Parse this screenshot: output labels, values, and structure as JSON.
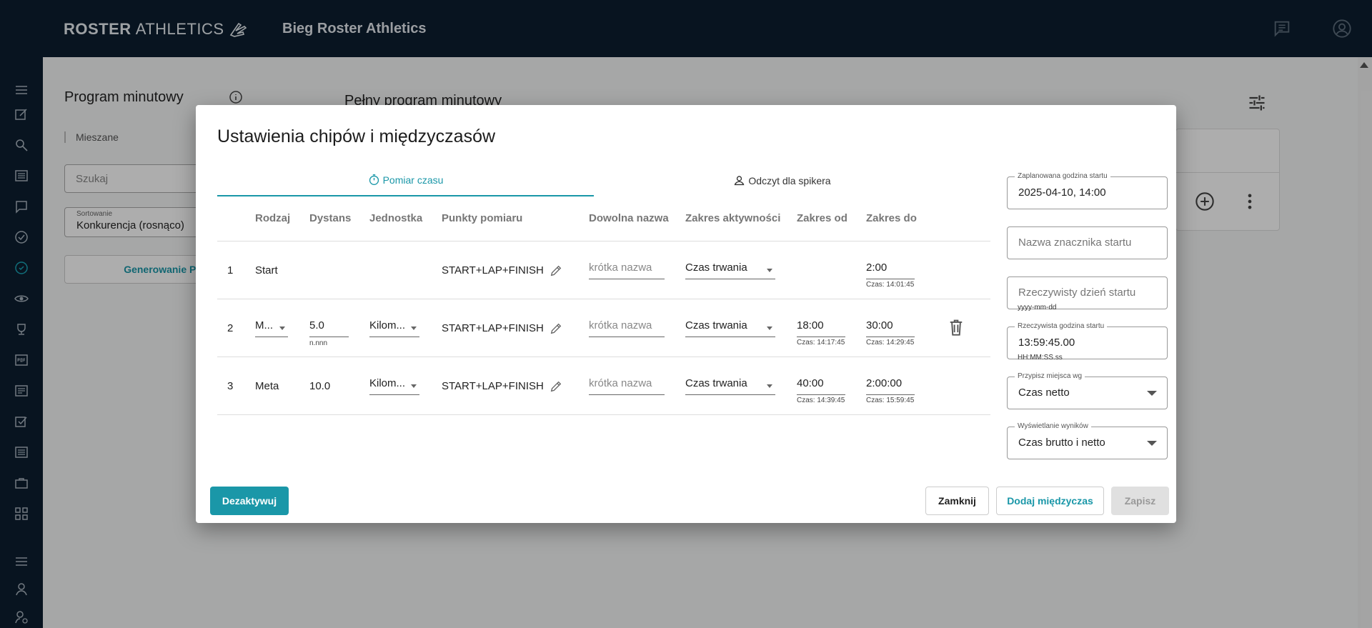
{
  "header": {
    "logo_bold": "ROSTER",
    "logo_light": "ATHLETICS",
    "event_title": "Bieg Roster Athletics"
  },
  "background": {
    "title": "Program minutowy",
    "full_title": "Pełny program minutowy",
    "tag": "Mieszane",
    "search_placeholder": "Szukaj",
    "sort_label": "Sortowanie",
    "sort_value": "Konkurencja (rosnąco)",
    "pdf_button": "Generowanie PDF"
  },
  "dialog": {
    "title": "Ustawienia chipów i międzyczasów",
    "tabs": [
      {
        "label": "Pomiar czasu",
        "icon": "timer-icon",
        "active": true
      },
      {
        "label": "Odczyt dla spikera",
        "icon": "person-icon",
        "active": false
      }
    ],
    "columns": [
      "Rodzaj",
      "Dystans",
      "Jednostka",
      "Punkty pomiaru",
      "Dowolna nazwa",
      "Zakres aktywności",
      "Zakres od",
      "Zakres do"
    ],
    "rows": [
      {
        "num": "1",
        "type": "Start",
        "distance": "",
        "distance_hint": "",
        "unit": "",
        "points": "START+LAP+FINISH",
        "name_placeholder": "krótka nazwa",
        "activity": "Czas trwania",
        "from": "",
        "from_hint": "",
        "to": "2:00",
        "to_hint": "Czas: 14:01:45"
      },
      {
        "num": "2",
        "type": "M...",
        "distance": "5.0",
        "distance_hint": "n.nnn",
        "unit": "Kilom...",
        "points": "START+LAP+FINISH",
        "name_placeholder": "krótka nazwa",
        "activity": "Czas trwania",
        "from": "18:00",
        "from_hint": "Czas: 14:17:45",
        "to": "30:00",
        "to_hint": "Czas: 14:29:45"
      },
      {
        "num": "3",
        "type": "Meta",
        "distance": "10.0",
        "distance_hint": "",
        "unit": "Kilom...",
        "points": "START+LAP+FINISH",
        "name_placeholder": "krótka nazwa",
        "activity": "Czas trwania",
        "from": "40:00",
        "from_hint": "Czas: 14:39:45",
        "to": "2:00:00",
        "to_hint": "Czas: 15:59:45"
      }
    ],
    "side": {
      "planned_label": "Zaplanowana godzina startu",
      "planned_value": "2025-04-10, 14:00",
      "marker_placeholder": "Nazwa znacznika startu",
      "real_day_placeholder": "Rzeczywisty dzień startu",
      "real_day_hint": "yyyy-mm-dd",
      "real_time_label": "Rzeczywista godzina startu",
      "real_time_value": "13:59:45.00",
      "real_time_hint": "HH:MM:SS.ss",
      "assign_label": "Przypisz miejsca wg",
      "assign_value": "Czas netto",
      "display_label": "Wyświetlanie wyników",
      "display_value": "Czas brutto i netto"
    },
    "buttons": {
      "deactivate": "Dezaktywuj",
      "close": "Zamknij",
      "add_split": "Dodaj międzyczas",
      "save": "Zapisz"
    }
  },
  "colors": {
    "topbar": "#0c1e30",
    "accent": "#1a97a8"
  }
}
